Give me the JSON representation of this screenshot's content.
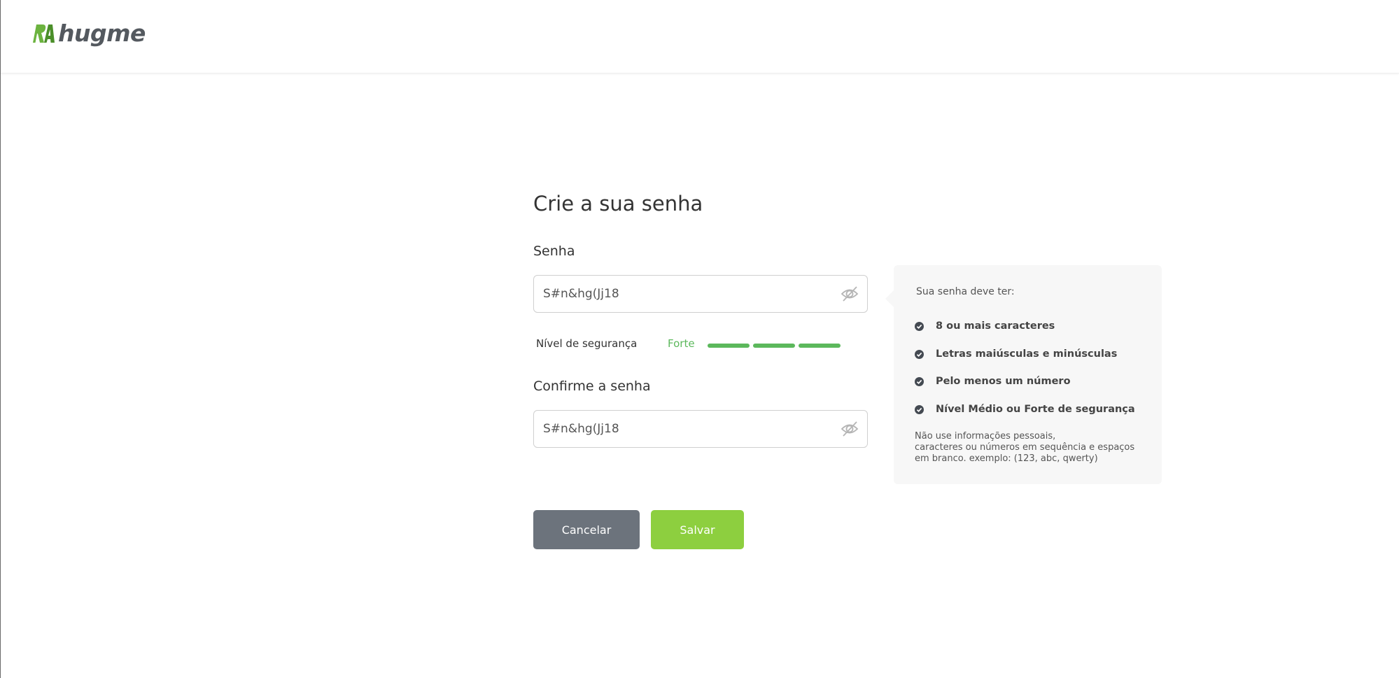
{
  "header": {
    "logo_text": "hugme",
    "logo_mark_text": "RA"
  },
  "form": {
    "title": "Crie a sua senha",
    "password_label": "Senha",
    "password_value": "S#n&hg(Jj18",
    "confirm_label": "Confirme a senha",
    "confirm_value": "S#n&hg(Jj18",
    "strength_label": "Nível de segurança",
    "strength_value": "Forte",
    "strength_filled_bars": 3,
    "strength_total_bars": 3
  },
  "requirements": {
    "title": "Sua senha deve ter:",
    "items": [
      "8 ou mais caracteres",
      "Letras maiúsculas e minúsculas",
      "Pelo menos um número",
      "Nível Médio ou Forte de segurança"
    ],
    "note_lines": [
      "Não use informações pessoais,",
      "caracteres ou números em sequência e espaços",
      "em branco. exemplo: (123, abc, qwerty)"
    ]
  },
  "buttons": {
    "cancel": "Cancelar",
    "save": "Salvar"
  },
  "colors": {
    "brand_green": "#8dcf3f",
    "strength_green": "#5cb85c",
    "cancel_gray": "#6c737c"
  },
  "icons": {
    "eye_toggle": "eye-off-icon",
    "requirement_check": "check-circle-icon"
  }
}
